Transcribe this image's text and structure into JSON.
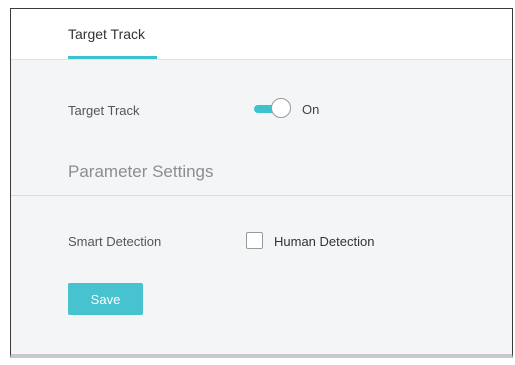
{
  "tabs": [
    {
      "label": "Target Track",
      "active": true
    }
  ],
  "target_track": {
    "label": "Target Track",
    "toggle_state": "On",
    "enabled": true
  },
  "parameter_settings": {
    "title": "Parameter Settings",
    "smart_detection": {
      "label": "Smart Detection",
      "option_label": "Human Detection",
      "checked": false
    }
  },
  "actions": {
    "save_label": "Save"
  },
  "colors": {
    "accent": "#3cc3cd",
    "button": "#46c3ce",
    "panel_background": "#f4f5f6"
  }
}
